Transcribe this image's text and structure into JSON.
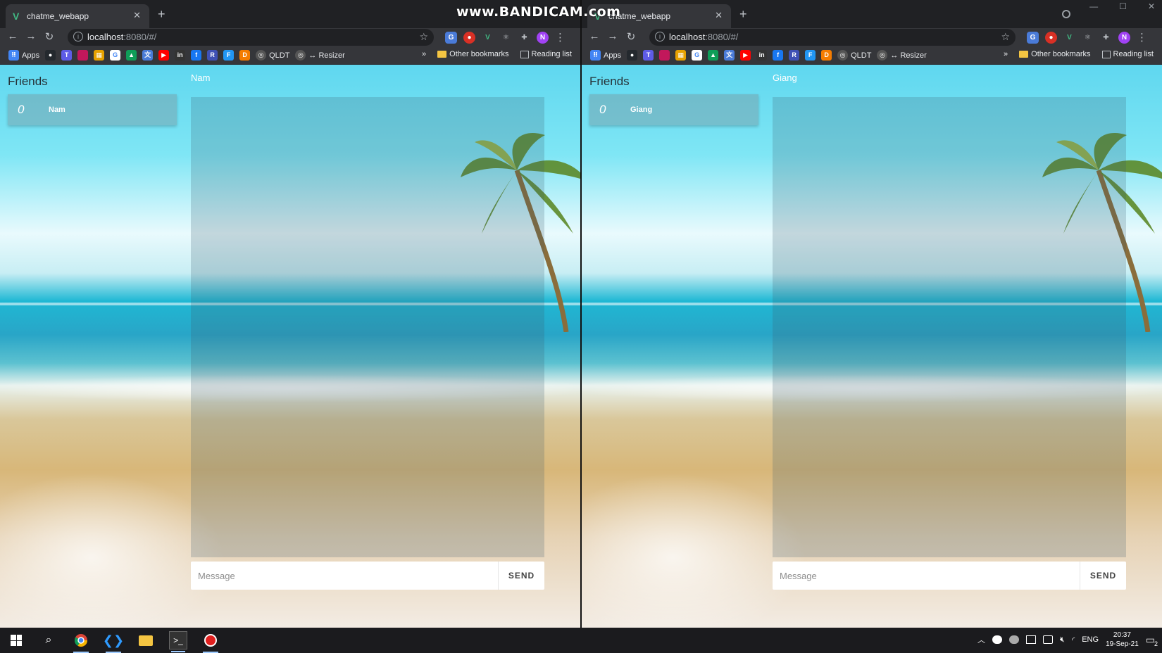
{
  "recorder_watermark": "www.BANDICAM.com",
  "browser": {
    "tab_title": "chatme_webapp",
    "tab_favicon": "vue-favicon-icon",
    "url_host": "localhost",
    "url_rest": ":8080/#/",
    "profile_initial": "N",
    "bookmarks": {
      "apps": "Apps",
      "qldt": "QLDT",
      "resizer": "↔ Resizer",
      "overflow": "»",
      "other": "Other bookmarks",
      "reading_list": "Reading list"
    }
  },
  "app": {
    "friends_title": "Friends",
    "message_placeholder": "Message",
    "send_label": "SEND"
  },
  "left": {
    "friend_name": "Nam",
    "friend_count": "0",
    "chat_name": "Nam"
  },
  "right": {
    "friend_name": "Giang",
    "friend_count": "0",
    "chat_name": "Giang"
  },
  "taskbar": {
    "time": "20:37",
    "date": "19-Sep-21",
    "language": "ENG",
    "notifications": "2"
  },
  "colors": {
    "accent_vue": "#41b883",
    "chrome_dark": "#35363a",
    "avatar": "#a142f4"
  }
}
